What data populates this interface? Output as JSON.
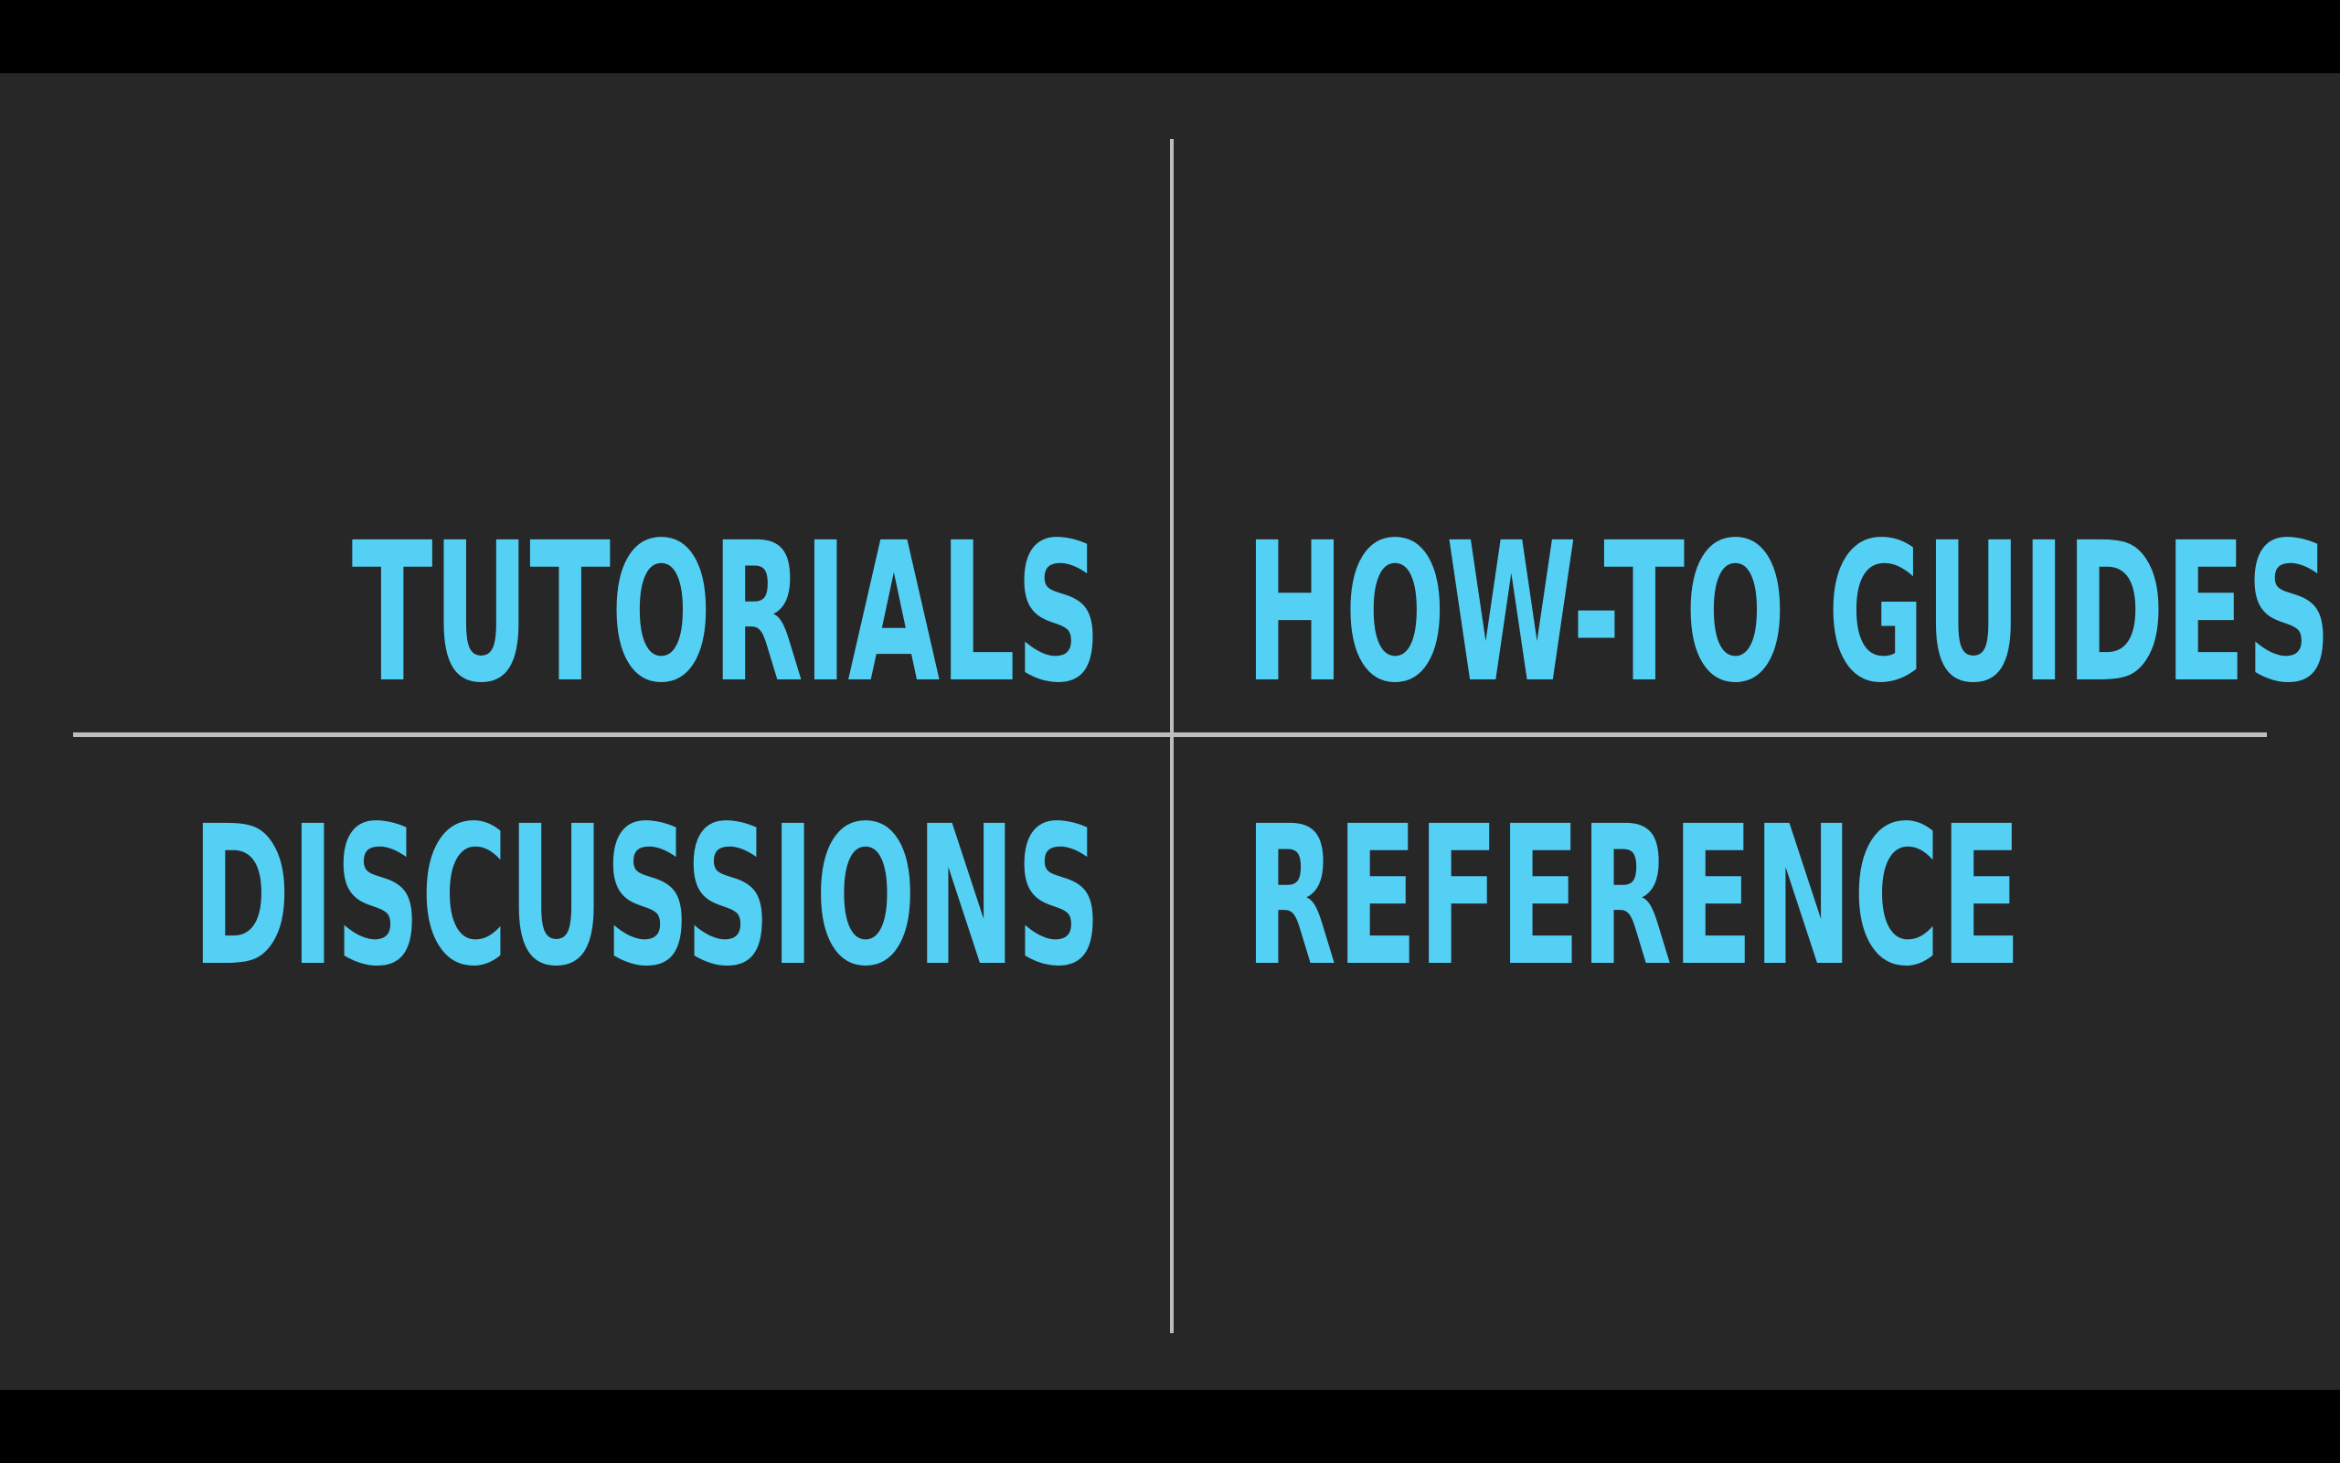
{
  "quadrants": {
    "top_left": "TUTORIALS",
    "top_right": "HOW-TO GUIDES",
    "bottom_left": "DISCUSSIONS",
    "bottom_right": "REFERENCE"
  },
  "colors": {
    "background": "#272727",
    "letterbox": "#000000",
    "label": "#55d0f5",
    "axis": "#bdbdbd"
  }
}
